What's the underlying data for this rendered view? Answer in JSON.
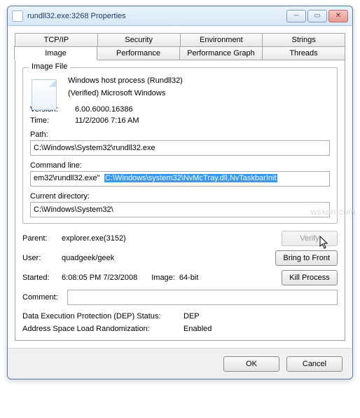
{
  "title": "rundll32.exe:3268 Properties",
  "tabs": {
    "tcpip": "TCP/IP",
    "security": "Security",
    "environment": "Environment",
    "strings": "Strings",
    "image": "Image",
    "performance": "Performance",
    "perfgraph": "Performance Graph",
    "threads": "Threads"
  },
  "group": {
    "title": "Image File"
  },
  "file": {
    "desc": "Windows host process (Rundll32)",
    "verified": "(Verified) Microsoft Windows",
    "version_label": "Version:",
    "version": "6.00.6000.16386",
    "time_label": "Time:",
    "time": "11/2/2006 7:16 AM"
  },
  "labels": {
    "path": "Path:",
    "cmdline": "Command line:",
    "curdir": "Current directory:",
    "parent": "Parent:",
    "user": "User:",
    "started": "Started:",
    "image": "Image:",
    "comment": "Comment:",
    "dep": "Data Execution Protection (DEP) Status:",
    "aslr": "Address Space Load Randomization:"
  },
  "values": {
    "path": "C:\\Windows\\System32\\rundll32.exe",
    "cmdline_plain": "em32\\rundll32.exe\" ",
    "cmdline_sel": "C:\\Windows\\system32\\NvMcTray.dll,NvTaskbarInit",
    "curdir": "C:\\Windows\\System32\\",
    "parent": "explorer.exe(3152)",
    "user": "quadgeek/geek",
    "started": "6:08:05 PM  7/23/2008",
    "image": "64-bit",
    "comment": "",
    "dep": "DEP",
    "aslr": "Enabled"
  },
  "buttons": {
    "verify": "Verify",
    "bringtofront": "Bring to Front",
    "killprocess": "Kill Process",
    "ok": "OK",
    "cancel": "Cancel"
  },
  "watermark": "wsxdn.com"
}
